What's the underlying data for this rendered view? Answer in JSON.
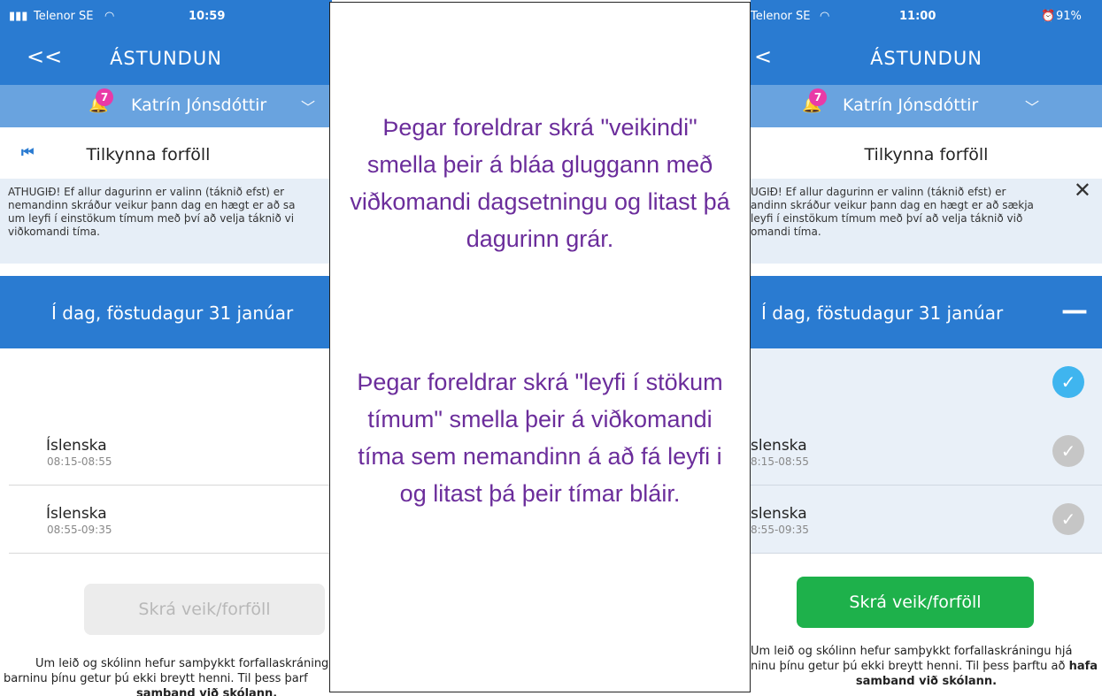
{
  "left_phone": {
    "status": {
      "carrier": "Telenor SE",
      "time": "10:59"
    },
    "appbar": {
      "back": "<<",
      "title": "ÁSTUNDUN"
    },
    "user": {
      "badge": "7",
      "name": "Katrín Jónsdóttir"
    },
    "subheader": {
      "title": "Tilkynna forföll"
    },
    "notice": "ATHUGIÐ! Ef allur dagurinn er valinn (táknið efst) er\nnemandinn skráður veikur þann dag en hægt er að sa\num leyfi í einstökum tímum með því að velja táknið vi\nviðkomandi tíma.",
    "day": "Í dag, föstudagur 31 janúar",
    "lessons": [
      {
        "subject": "Íslenska",
        "time": "08:15-08:55"
      },
      {
        "subject": "Íslenska",
        "time": "08:55-09:35"
      }
    ],
    "button": "Skrá veik/forföll",
    "footnote_line1": "Um leið og skólinn hefur samþykkt forfallaskráning",
    "footnote_line2": "barninu þínu getur þú ekki breytt henni. Til þess þarf",
    "footnote_line3": "samband við skólann."
  },
  "overlay": {
    "text1": "Þegar foreldrar skrá \"veikindi\" smella þeir á bláa gluggann með viðkomandi dagsetningu og litast þá dagurinn grár.",
    "text2": "Þegar foreldrar skrá \"leyfi í stökum tímum\" smella þeir á viðkomandi tíma sem nemandinn á að fá leyfi i og litast þá þeir tímar bláir."
  },
  "right_phone": {
    "status": {
      "carrier": "Telenor SE",
      "time": "11:00",
      "battery": "91%"
    },
    "appbar": {
      "back": "<",
      "title": "ÁSTUNDUN"
    },
    "user": {
      "badge": "7",
      "name": "Katrín Jónsdóttir"
    },
    "subheader": {
      "title": "Tilkynna forföll"
    },
    "notice": "UGIÐ! Ef allur dagurinn er valinn (táknið efst) er\nandinn skráður veikur þann dag en hægt er að sækja\nleyfi í einstökum tímum með því að velja táknið við\nomandi tíma.",
    "day": "Í dag, föstudagur 31 janúar",
    "lessons": [
      {
        "subject": "slenska",
        "time": "8:15-08:55"
      },
      {
        "subject": "slenska",
        "time": "8:55-09:35"
      }
    ],
    "button": "Skrá veik/forföll",
    "footnote_line1": "Um leið og skólinn hefur samþykkt forfallaskráningu hjá",
    "footnote_line2a": "ninu þínu getur þú ekki breytt henni. Til þess þarftu að ",
    "footnote_line2b": "hafa",
    "footnote_line3": "samband við skólann."
  },
  "colors": {
    "primary_blue": "#2a7bd1",
    "light_blue": "#69a3df",
    "green": "#1eb14b",
    "check_blue": "#3fb5ef",
    "overlay_text": "#6b2d9b"
  }
}
